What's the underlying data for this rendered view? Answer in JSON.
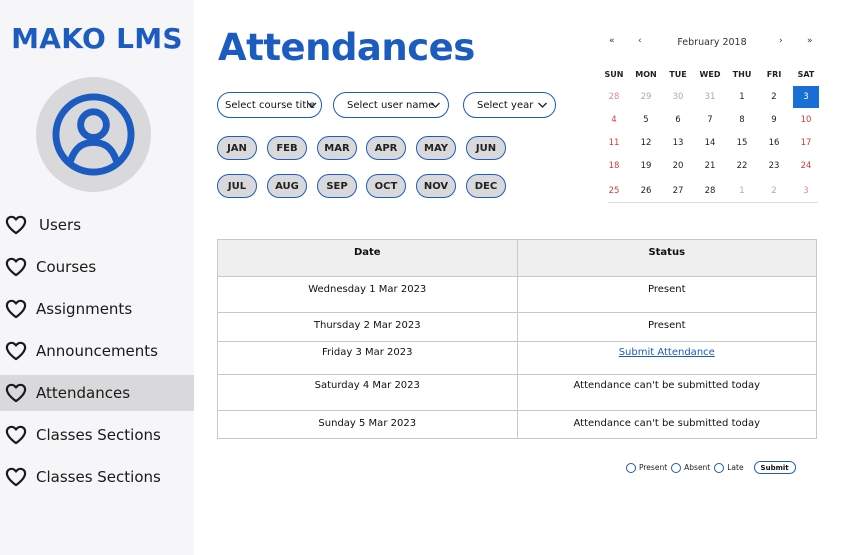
{
  "sidebar": {
    "brand": "MAKO LMS",
    "items": [
      {
        "label": "Users"
      },
      {
        "label": "Courses"
      },
      {
        "label": "Assignments"
      },
      {
        "label": "Announcements"
      },
      {
        "label": "Attendances"
      },
      {
        "label": "Classes Sections"
      },
      {
        "label": "Classes Sections"
      }
    ],
    "active_item": "Attendances"
  },
  "main": {
    "title": "Attendances",
    "filters": {
      "course": "Select course title",
      "user": "Select user name",
      "year": "Select year"
    },
    "months": [
      "JAN",
      "FEB",
      "MAR",
      "APR",
      "MAY",
      "JUN",
      "JUL",
      "AUG",
      "SEP",
      "OCT",
      "NOV",
      "DEC"
    ]
  },
  "calendar": {
    "title": "February 2018",
    "nav": {
      "prev_year": "«",
      "prev": "‹",
      "next": "›",
      "next_year": "»"
    },
    "weekdays": [
      "SUN",
      "MON",
      "TUE",
      "WED",
      "THU",
      "FRI",
      "SAT"
    ],
    "weeks": [
      [
        "28",
        "29",
        "30",
        "31",
        "1",
        "2",
        "3"
      ],
      [
        "4",
        "5",
        "6",
        "7",
        "8",
        "9",
        "10"
      ],
      [
        "11",
        "12",
        "13",
        "14",
        "15",
        "16",
        "17"
      ],
      [
        "18",
        "19",
        "20",
        "21",
        "22",
        "23",
        "24"
      ],
      [
        "25",
        "26",
        "27",
        "28",
        "1",
        "2",
        "3"
      ]
    ],
    "selected": "3"
  },
  "table": {
    "headers": {
      "date": "Date",
      "status": "Status"
    },
    "rows": [
      {
        "date": "Wednesday 1 Mar 2023",
        "status": "Present"
      },
      {
        "date": "Thursday 2 Mar 2023",
        "status": "Present"
      },
      {
        "date": "Friday 3 Mar 2023",
        "status": "Submit Attendance"
      },
      {
        "date": "Saturday 4 Mar 2023",
        "status": "Attendance can't be submitted today"
      },
      {
        "date": "Sunday 5 Mar 2023",
        "status": "Attendance can't be submitted today"
      }
    ]
  },
  "attendance_form": {
    "options": [
      "Present",
      "Absent",
      "Late"
    ],
    "submit_label": "Submit"
  },
  "colors": {
    "accent": "#1c5bc0",
    "selected_day": "#1a6fd6",
    "weekend": "#d23a3a",
    "sidebar_bg": "#f6f6f8"
  }
}
